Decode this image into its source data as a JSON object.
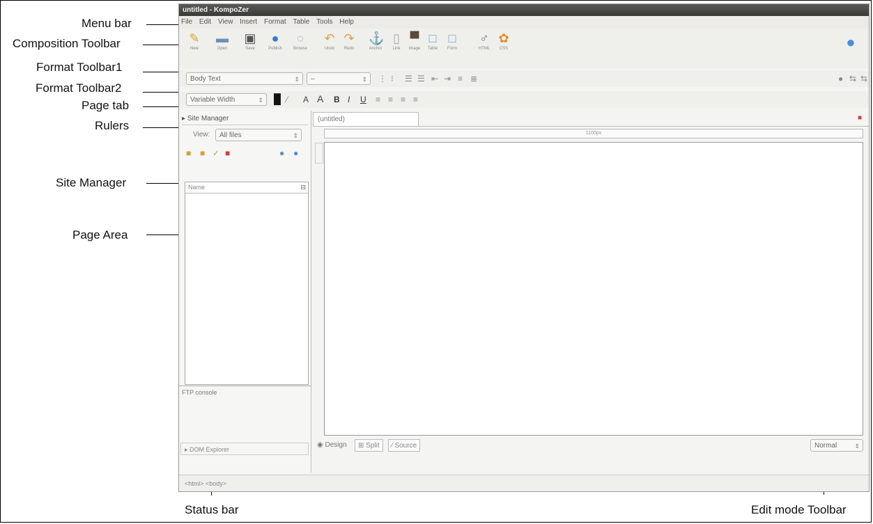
{
  "labels": {
    "menu_bar": "Menu bar",
    "composition_toolbar": "Composition Toolbar",
    "format_toolbar1": "Format Toolbar1",
    "format_toolbar2": "Format Toolbar2",
    "page_tab": "Page tab",
    "rulers": "Rulers",
    "site_manager": "Site Manager",
    "page_area": "Page Area",
    "status_bar": "Status bar",
    "edit_mode_toolbar": "Edit mode Toolbar"
  },
  "app": {
    "title": "untitled - KompoZer",
    "menu": [
      "File",
      "Edit",
      "View",
      "Insert",
      "Format",
      "Table",
      "Tools",
      "Help"
    ],
    "toolbar": [
      "New",
      "Open",
      "Save",
      "Publish",
      "Browse",
      "Undo",
      "Redo",
      "Anchor",
      "Link",
      "Image",
      "Table",
      "Form",
      "HTML",
      "CSS"
    ],
    "paragraph_style": "Body Text",
    "font": "Variable Width",
    "site_manager_title": "Site Manager",
    "view_label": "View:",
    "view_value": "All files",
    "name_column": "Name",
    "ftp_console": "FTP console",
    "dom_explorer": "DOM Explorer",
    "page_tab": "(untitled)",
    "ruler_text": "1100px",
    "modes": [
      "Design",
      "Split",
      "Source"
    ],
    "edit_mode_select": "Normal",
    "status_path": "<html> <body>"
  }
}
